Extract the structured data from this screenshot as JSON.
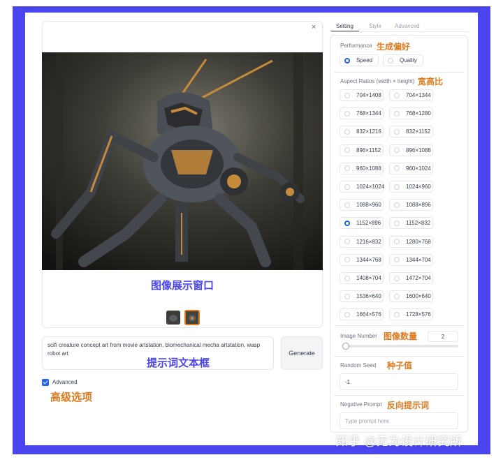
{
  "viewer": {
    "close_icon": "close-icon",
    "caption": "图像展示窗口"
  },
  "prompt": {
    "text": "scifi creature concept art from movie artstation, biomechanical mecha artstation, wasp robot art",
    "annotation": "提示词文本框"
  },
  "generate_label": "Generate",
  "advanced": {
    "label": "Advanced",
    "checked": true,
    "annotation": "高级选项"
  },
  "tabs": [
    "Setting",
    "Style",
    "Advanced"
  ],
  "performance": {
    "label": "Performance",
    "annotation": "生成偏好",
    "options": [
      "Speed",
      "Quality"
    ],
    "selected": "Speed"
  },
  "aspect": {
    "label": "Aspect Ratios (width × height)",
    "annotation": "宽高比",
    "options": [
      "704×1408",
      "704×1344",
      "768×1344",
      "768×1280",
      "832×1216",
      "832×1152",
      "896×1152",
      "896×1088",
      "960×1088",
      "960×1024",
      "1024×1024",
      "1024×960",
      "1088×960",
      "1088×896",
      "1152×896",
      "1152×832",
      "1216×832",
      "1280×768",
      "1344×768",
      "1344×704",
      "1408×704",
      "1472×704",
      "1536×640",
      "1600×640",
      "1664×576",
      "1728×576"
    ],
    "selected": "1152×896"
  },
  "image_number": {
    "label": "Image Number",
    "annotation": "图像数量",
    "value": "2",
    "slider_fraction": 0.0
  },
  "seed": {
    "label": "Random Seed",
    "annotation": "种子值",
    "value": "-1"
  },
  "negative": {
    "label": "Negative Prompt",
    "annotation": "反向提示词",
    "placeholder": "Type prompt here."
  },
  "watermark": "知乎 @无为设计研究所",
  "colors": {
    "frame": "#4a45ee",
    "annotation_blue": "#4a45ee",
    "annotation_orange": "#e07a1f",
    "accent": "#2563eb"
  }
}
